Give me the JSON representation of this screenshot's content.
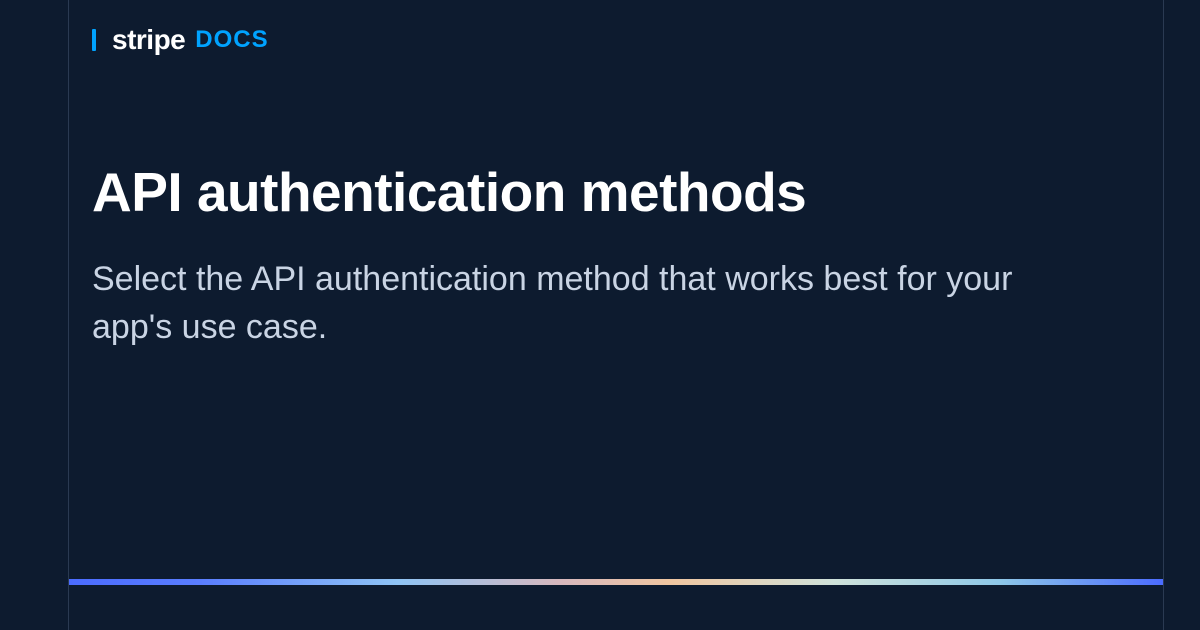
{
  "brand": {
    "logo_text": "stripe",
    "docs_label": "DOCS"
  },
  "page": {
    "title": "API authentication methods",
    "subtitle": "Select the API authentication method that works best for your app's use case."
  },
  "colors": {
    "background": "#0d1b2f",
    "accent": "#00a3ff",
    "title": "#ffffff",
    "subtitle": "#c9d4e4",
    "border": "#2a3a52"
  }
}
